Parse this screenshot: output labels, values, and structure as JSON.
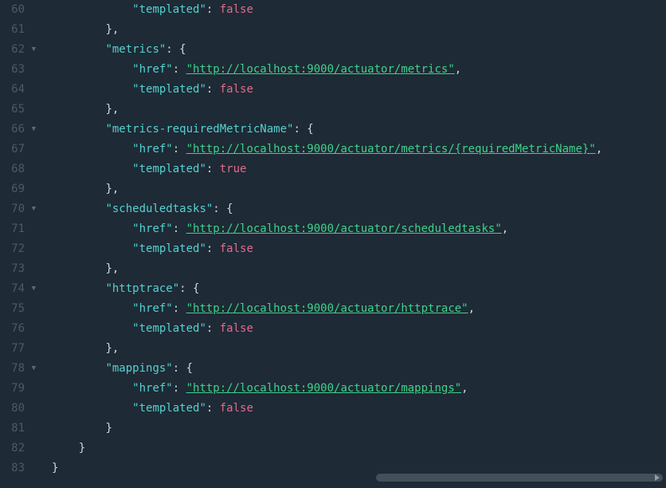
{
  "lines": [
    {
      "num": "60",
      "fold": "",
      "indent": 12,
      "tokens": [
        {
          "t": "key",
          "v": "\"templated\""
        },
        {
          "t": "punct",
          "v": ": "
        },
        {
          "t": "bool",
          "v": "false"
        }
      ]
    },
    {
      "num": "61",
      "fold": "",
      "indent": 8,
      "tokens": [
        {
          "t": "punct",
          "v": "},"
        }
      ]
    },
    {
      "num": "62",
      "fold": "▼",
      "indent": 8,
      "tokens": [
        {
          "t": "key",
          "v": "\"metrics\""
        },
        {
          "t": "punct",
          "v": ": {"
        }
      ]
    },
    {
      "num": "63",
      "fold": "",
      "indent": 12,
      "tokens": [
        {
          "t": "key",
          "v": "\"href\""
        },
        {
          "t": "punct",
          "v": ": "
        },
        {
          "t": "url",
          "v": "\"http://localhost:9000/actuator/metrics\""
        },
        {
          "t": "punct",
          "v": ","
        }
      ]
    },
    {
      "num": "64",
      "fold": "",
      "indent": 12,
      "tokens": [
        {
          "t": "key",
          "v": "\"templated\""
        },
        {
          "t": "punct",
          "v": ": "
        },
        {
          "t": "bool",
          "v": "false"
        }
      ]
    },
    {
      "num": "65",
      "fold": "",
      "indent": 8,
      "tokens": [
        {
          "t": "punct",
          "v": "},"
        }
      ]
    },
    {
      "num": "66",
      "fold": "▼",
      "indent": 8,
      "tokens": [
        {
          "t": "key",
          "v": "\"metrics-requiredMetricName\""
        },
        {
          "t": "punct",
          "v": ": {"
        }
      ]
    },
    {
      "num": "67",
      "fold": "",
      "indent": 12,
      "tokens": [
        {
          "t": "key",
          "v": "\"href\""
        },
        {
          "t": "punct",
          "v": ": "
        },
        {
          "t": "url",
          "v": "\"http://localhost:9000/actuator/metrics/{requiredMetricName}\""
        },
        {
          "t": "punct",
          "v": ","
        }
      ]
    },
    {
      "num": "68",
      "fold": "",
      "indent": 12,
      "tokens": [
        {
          "t": "key",
          "v": "\"templated\""
        },
        {
          "t": "punct",
          "v": ": "
        },
        {
          "t": "bool",
          "v": "true"
        }
      ]
    },
    {
      "num": "69",
      "fold": "",
      "indent": 8,
      "tokens": [
        {
          "t": "punct",
          "v": "},"
        }
      ]
    },
    {
      "num": "70",
      "fold": "▼",
      "indent": 8,
      "tokens": [
        {
          "t": "key",
          "v": "\"scheduledtasks\""
        },
        {
          "t": "punct",
          "v": ": {"
        }
      ]
    },
    {
      "num": "71",
      "fold": "",
      "indent": 12,
      "tokens": [
        {
          "t": "key",
          "v": "\"href\""
        },
        {
          "t": "punct",
          "v": ": "
        },
        {
          "t": "url",
          "v": "\"http://localhost:9000/actuator/scheduledtasks\""
        },
        {
          "t": "punct",
          "v": ","
        }
      ]
    },
    {
      "num": "72",
      "fold": "",
      "indent": 12,
      "tokens": [
        {
          "t": "key",
          "v": "\"templated\""
        },
        {
          "t": "punct",
          "v": ": "
        },
        {
          "t": "bool",
          "v": "false"
        }
      ]
    },
    {
      "num": "73",
      "fold": "",
      "indent": 8,
      "tokens": [
        {
          "t": "punct",
          "v": "},"
        }
      ]
    },
    {
      "num": "74",
      "fold": "▼",
      "indent": 8,
      "tokens": [
        {
          "t": "key",
          "v": "\"httptrace\""
        },
        {
          "t": "punct",
          "v": ": {"
        }
      ]
    },
    {
      "num": "75",
      "fold": "",
      "indent": 12,
      "tokens": [
        {
          "t": "key",
          "v": "\"href\""
        },
        {
          "t": "punct",
          "v": ": "
        },
        {
          "t": "url",
          "v": "\"http://localhost:9000/actuator/httptrace\""
        },
        {
          "t": "punct",
          "v": ","
        }
      ]
    },
    {
      "num": "76",
      "fold": "",
      "indent": 12,
      "tokens": [
        {
          "t": "key",
          "v": "\"templated\""
        },
        {
          "t": "punct",
          "v": ": "
        },
        {
          "t": "bool",
          "v": "false"
        }
      ]
    },
    {
      "num": "77",
      "fold": "",
      "indent": 8,
      "tokens": [
        {
          "t": "punct",
          "v": "},"
        }
      ]
    },
    {
      "num": "78",
      "fold": "▼",
      "indent": 8,
      "tokens": [
        {
          "t": "key",
          "v": "\"mappings\""
        },
        {
          "t": "punct",
          "v": ": {"
        }
      ]
    },
    {
      "num": "79",
      "fold": "",
      "indent": 12,
      "tokens": [
        {
          "t": "key",
          "v": "\"href\""
        },
        {
          "t": "punct",
          "v": ": "
        },
        {
          "t": "url",
          "v": "\"http://localhost:9000/actuator/mappings\""
        },
        {
          "t": "punct",
          "v": ","
        }
      ]
    },
    {
      "num": "80",
      "fold": "",
      "indent": 12,
      "tokens": [
        {
          "t": "key",
          "v": "\"templated\""
        },
        {
          "t": "punct",
          "v": ": "
        },
        {
          "t": "bool",
          "v": "false"
        }
      ]
    },
    {
      "num": "81",
      "fold": "",
      "indent": 8,
      "tokens": [
        {
          "t": "punct",
          "v": "}"
        }
      ]
    },
    {
      "num": "82",
      "fold": "",
      "indent": 4,
      "tokens": [
        {
          "t": "punct",
          "v": "}"
        }
      ]
    },
    {
      "num": "83",
      "fold": "",
      "indent": 0,
      "tokens": [
        {
          "t": "punct",
          "v": "}"
        }
      ]
    }
  ]
}
